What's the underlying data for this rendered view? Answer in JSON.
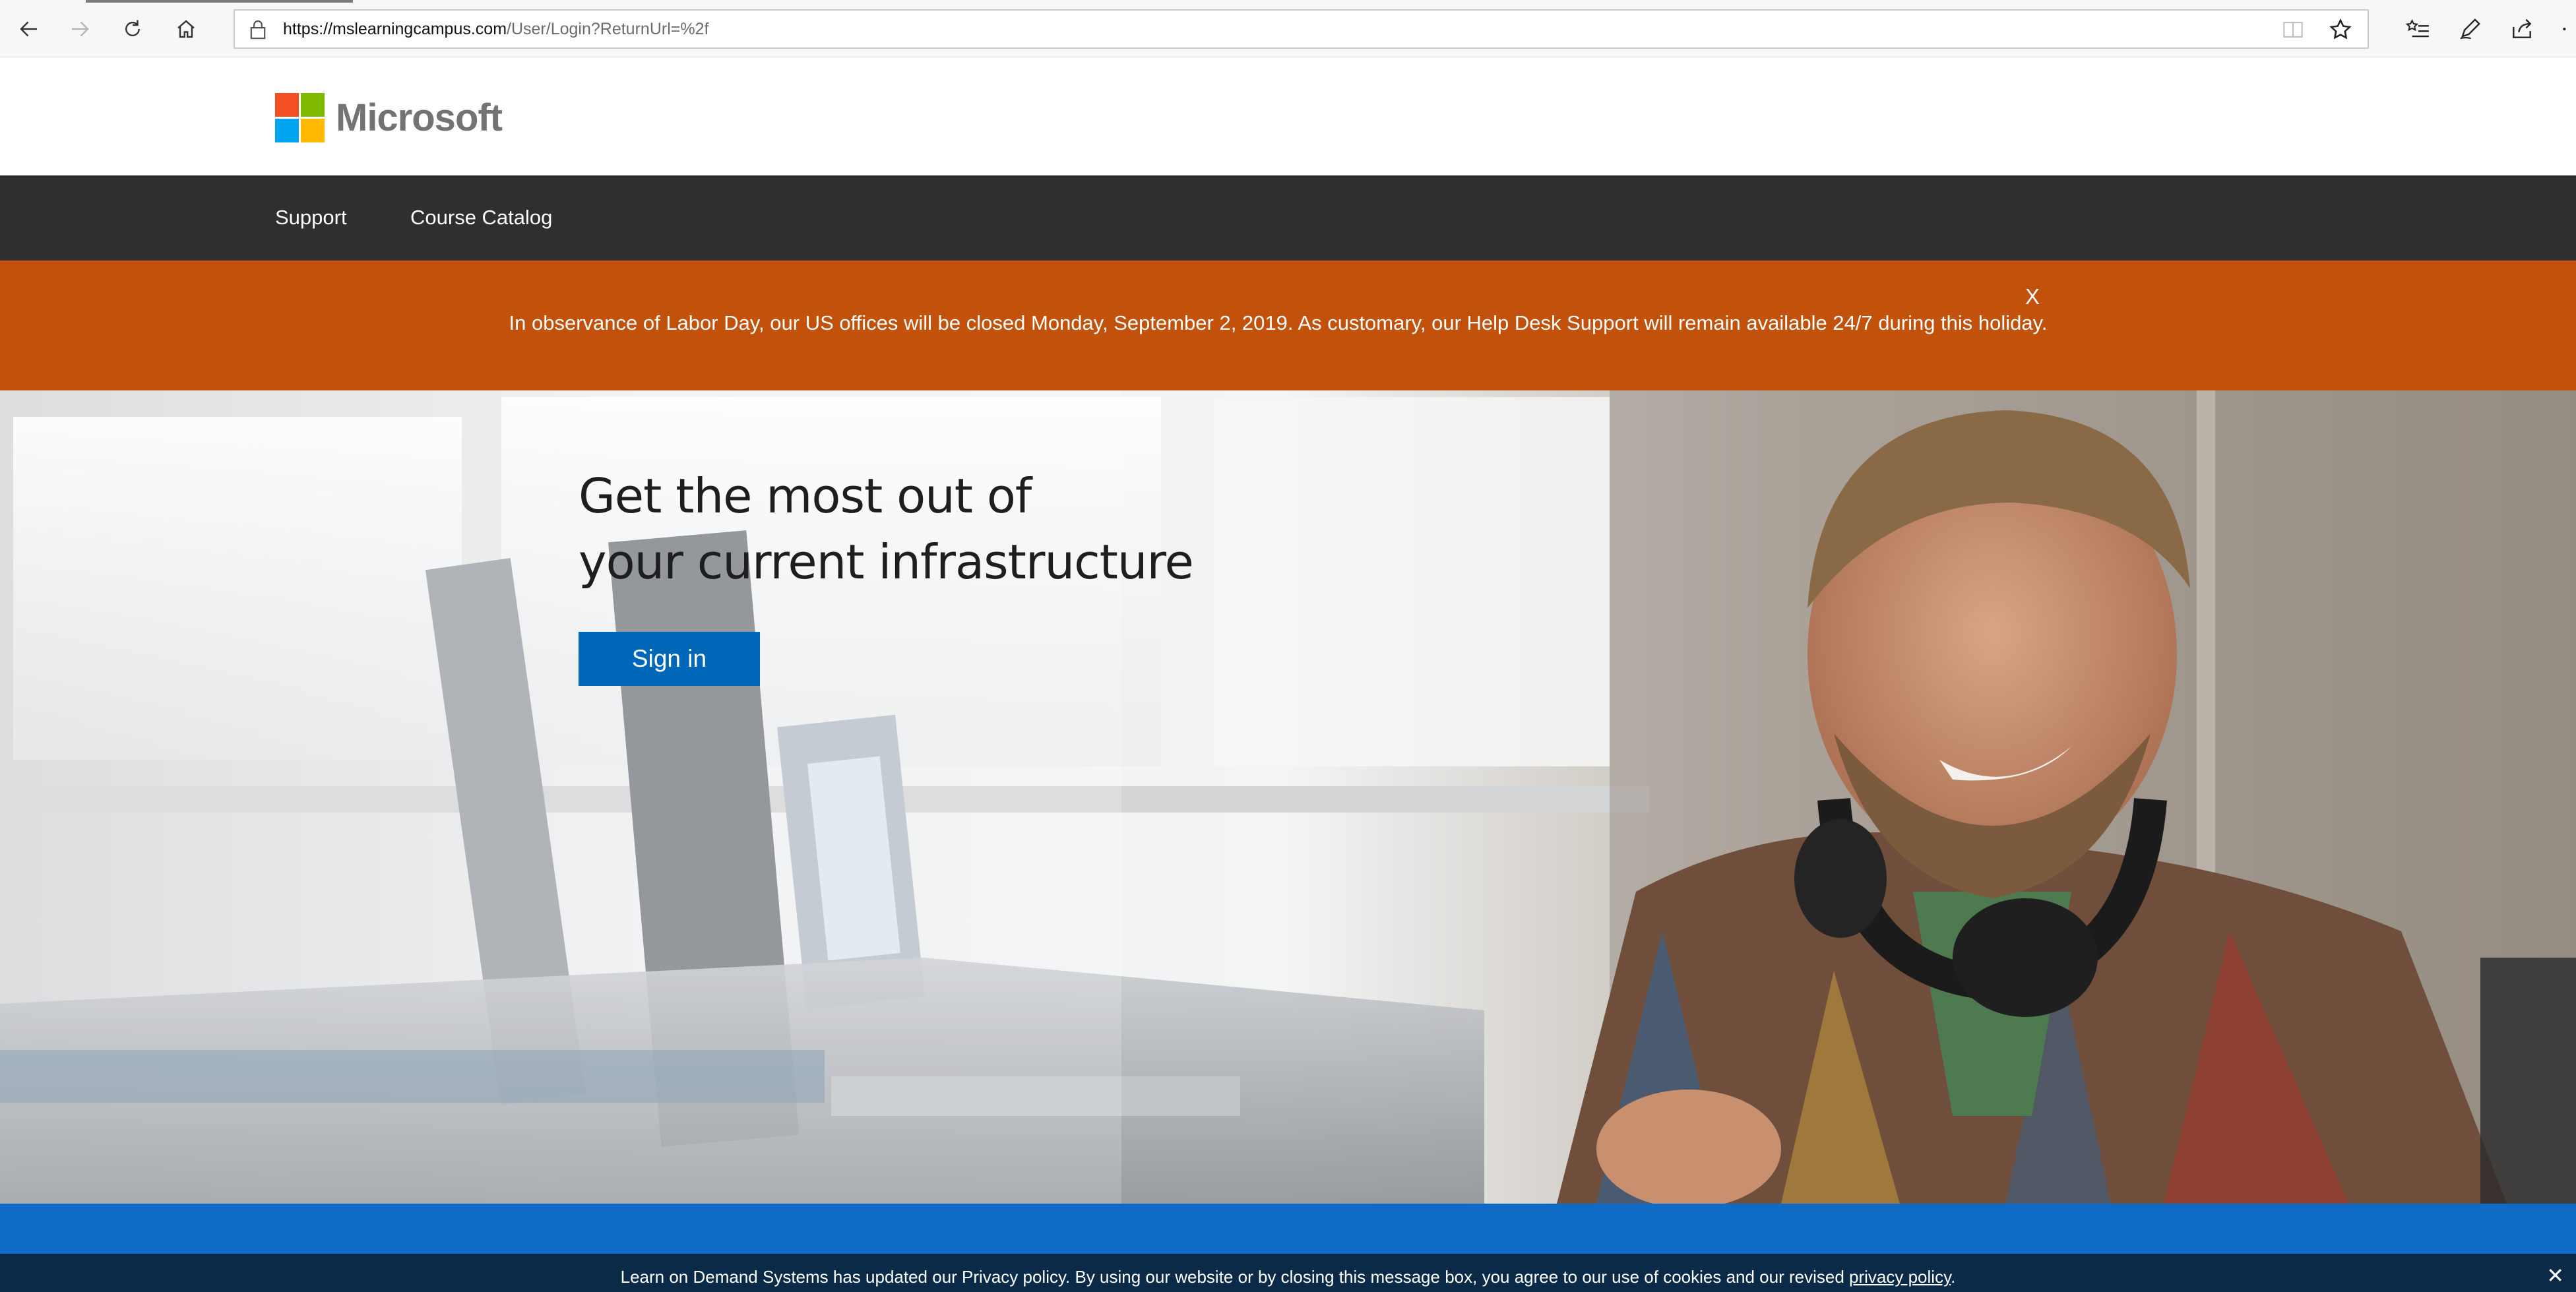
{
  "browser": {
    "url_host": "https://mslearningcampus.com",
    "url_path": "/User/Login?ReturnUrl=%2f"
  },
  "header": {
    "logo_text": "Microsoft",
    "logo_colors": [
      "#f25022",
      "#7fba00",
      "#00a4ef",
      "#ffb900"
    ]
  },
  "nav": {
    "items": [
      {
        "label": "Support"
      },
      {
        "label": "Course Catalog"
      }
    ]
  },
  "alert": {
    "text": "In observance of Labor Day, our US offices will be closed Monday, September 2, 2019. As customary, our Help Desk Support will remain available 24/7 during this holiday.",
    "close_label": "X",
    "color": "#c2510b"
  },
  "hero": {
    "heading_line1": "Get the most out of",
    "heading_line2": "your current infrastructure",
    "signin_label": "Sign in",
    "button_color": "#0067b8"
  },
  "cookie": {
    "text": "Learn on Demand Systems has updated our Privacy policy. By using our website or by closing this message box, you agree to our use of cookies and our revised ",
    "link_text": "privacy policy",
    "suffix": ".",
    "close_label": "✕"
  }
}
